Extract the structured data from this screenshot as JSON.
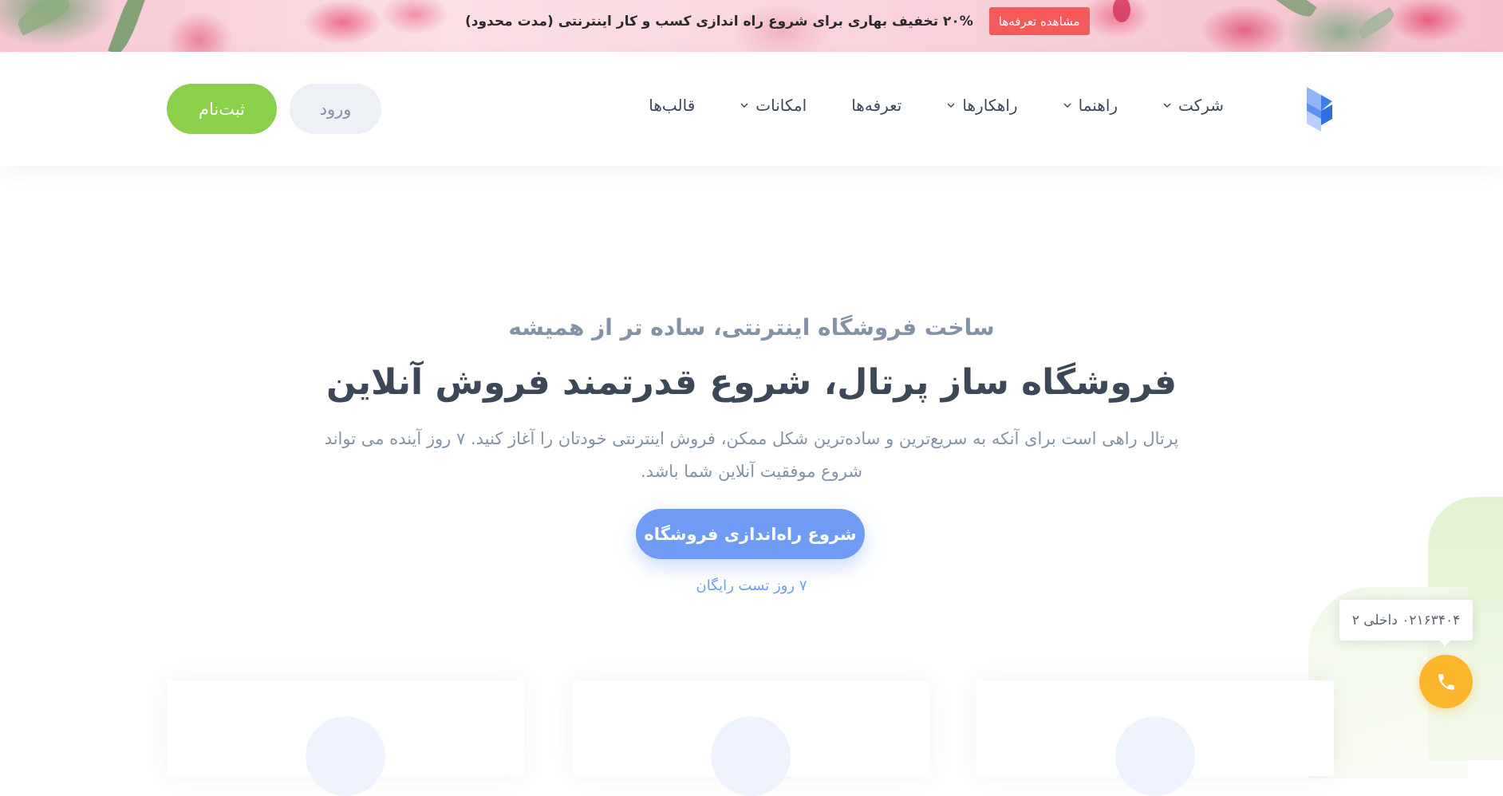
{
  "promo": {
    "text": "۲۰% تخفیف بهاری برای شروع راه اندازی کسب و کار اینترنتی (مدت محدود)",
    "button_label": "مشاهده تعرفه‌ها"
  },
  "header": {
    "nav": [
      {
        "label": "قالب‌ها",
        "has_dropdown": false
      },
      {
        "label": "امکانات",
        "has_dropdown": true
      },
      {
        "label": "تعرفه‌ها",
        "has_dropdown": false
      },
      {
        "label": "راهکارها",
        "has_dropdown": true
      },
      {
        "label": "راهنما",
        "has_dropdown": true
      },
      {
        "label": "شرکت",
        "has_dropdown": true
      }
    ],
    "login_label": "ورود",
    "signup_label": "ثبت‌نام"
  },
  "hero": {
    "subtitle": "ساخت فروشگاه اینترنتی، ساده تر از همیشه",
    "title": "فروشگاه ساز پرتال، شروع قدرتمند فروش آنلاین",
    "description": "پرتال راهی است برای آنکه به سریع‌ترین و ساده‌ترین شکل ممکن، فروش اینترنتی خودتان را آغاز کنید. ۷ روز آینده می تواند شروع موفقیت آنلاین شما باشد.",
    "cta_label": "شروع راه‌اندازی فروشگاه",
    "trial_note": "۷ روز تست رایگان"
  },
  "support": {
    "phone_text": "۰۲۱۶۳۴۰۴ داخلی ۲",
    "phone_icon": "phone-icon"
  },
  "colors": {
    "promo_button": "#f35b5b",
    "signup": "#8bd04a",
    "cta": "#6f9bf4",
    "phone": "#fbb62b"
  }
}
